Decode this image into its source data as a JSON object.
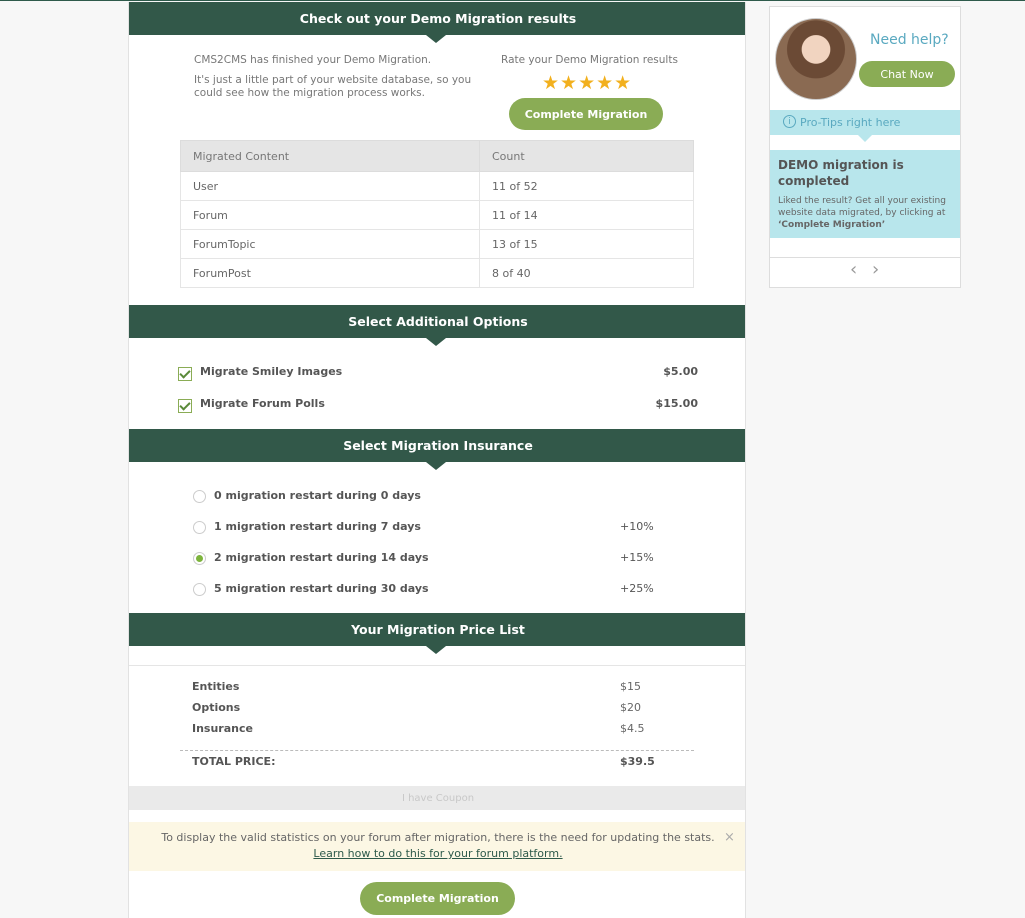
{
  "results": {
    "header": "Check out your Demo Migration results",
    "finished_text": "CMS2CMS has finished your Demo Migration.",
    "desc_line1": "It's just a little part of your website database, so you",
    "desc_line2": "could see how the migration process works.",
    "rate_label": "Rate your Demo Migration results",
    "rating": 5,
    "rating_stars": "★★★★★",
    "complete_button": "Complete Migration",
    "table": {
      "headers": [
        "Migrated Content",
        "Count"
      ],
      "rows": [
        {
          "content": "User",
          "count": "11 of 52"
        },
        {
          "content": "Forum",
          "count": "11 of 14"
        },
        {
          "content": "ForumTopic",
          "count": "13 of 15"
        },
        {
          "content": "ForumPost",
          "count": "8 of 40"
        }
      ]
    }
  },
  "options": {
    "header": "Select Additional Options",
    "items": [
      {
        "label": "Migrate Smiley Images",
        "price": "$5.00",
        "checked": true
      },
      {
        "label": "Migrate Forum Polls",
        "price": "$15.00",
        "checked": true
      }
    ]
  },
  "insurance": {
    "header": "Select Migration Insurance",
    "items": [
      {
        "label": "0 migration restart during 0 days",
        "extra": "",
        "selected": false
      },
      {
        "label": "1 migration restart during 7 days",
        "extra": "+10%",
        "selected": false
      },
      {
        "label": "2 migration restart during 14 days",
        "extra": "+15%",
        "selected": true
      },
      {
        "label": "5 migration restart during 30 days",
        "extra": "+25%",
        "selected": false
      }
    ]
  },
  "price_list": {
    "header": "Your Migration Price List",
    "rows": [
      {
        "label": "Entities",
        "value": "$15"
      },
      {
        "label": "Options",
        "value": "$20"
      },
      {
        "label": "Insurance",
        "value": "$4.5"
      }
    ],
    "total_label": "TOTAL PRICE:",
    "total_value": "$39.5"
  },
  "coupon_label": "I have Coupon",
  "notice": {
    "text": "To display the valid statistics on your forum after migration, there is the need for updating the stats.",
    "link": "Learn how to do this for your forum platform.",
    "close": "×"
  },
  "bottom_button": "Complete Migration",
  "sidebar": {
    "need_help": "Need help?",
    "chat_button": "Chat Now",
    "tips_label": "Pro-Tips right here",
    "info_glyph": "i",
    "tip_title": "DEMO migration is completed",
    "tip_body_1": "Liked the result? Get all your existing website data migrated, by clicking at",
    "tip_body_2": "‘Complete Migration’",
    "prev_glyph": "‹",
    "next_glyph": "›"
  },
  "colors": {
    "header_green": "#325849",
    "button_green": "#8aac55",
    "star": "#f2b01e",
    "tip_bg": "#b8e6ec",
    "help_text": "#5aa9c0"
  }
}
